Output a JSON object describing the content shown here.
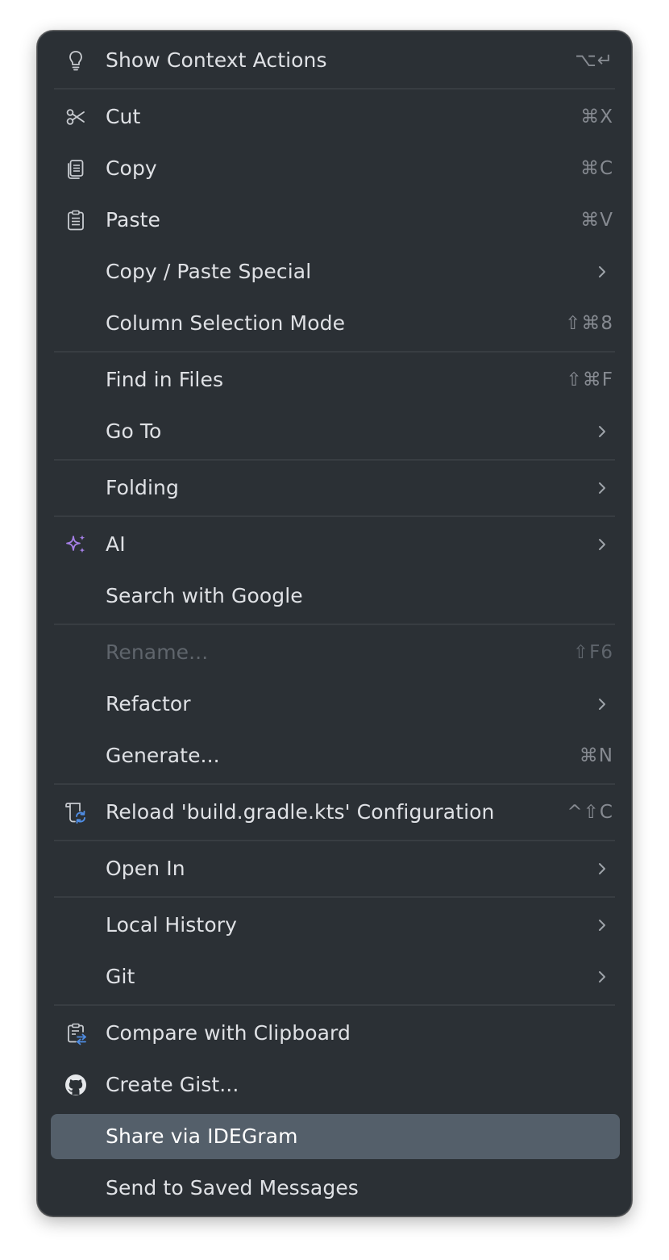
{
  "menu": {
    "show_context_actions": {
      "label": "Show Context Actions",
      "shortcut": "⌥↵",
      "icon": "lightbulb-icon"
    },
    "cut": {
      "label": "Cut",
      "shortcut": "⌘X",
      "icon": "scissors-icon"
    },
    "copy": {
      "label": "Copy",
      "shortcut": "⌘C",
      "icon": "copy-icon"
    },
    "paste": {
      "label": "Paste",
      "shortcut": "⌘V",
      "icon": "clipboard-icon"
    },
    "copy_paste_special": {
      "label": "Copy / Paste Special"
    },
    "column_selection_mode": {
      "label": "Column Selection Mode",
      "shortcut": "⇧⌘8"
    },
    "find_in_files": {
      "label": "Find in Files",
      "shortcut": "⇧⌘F"
    },
    "go_to": {
      "label": "Go To"
    },
    "folding": {
      "label": "Folding"
    },
    "ai": {
      "label": "AI",
      "icon": "ai-sparkle-icon",
      "icon_color": "#a57fe6"
    },
    "search_with_google": {
      "label": "Search with Google"
    },
    "rename": {
      "label": "Rename...",
      "shortcut": "⇧F6",
      "disabled": true
    },
    "refactor": {
      "label": "Refactor"
    },
    "generate": {
      "label": "Generate...",
      "shortcut": "⌘N"
    },
    "reload_gradle": {
      "label": "Reload 'build.gradle.kts' Configuration",
      "shortcut": "^⇧C",
      "icon": "gradle-reload-icon"
    },
    "open_in": {
      "label": "Open In"
    },
    "local_history": {
      "label": "Local History"
    },
    "git": {
      "label": "Git"
    },
    "compare_with_clipboard": {
      "label": "Compare with Clipboard",
      "icon": "compare-clipboard-icon"
    },
    "create_gist": {
      "label": "Create Gist...",
      "icon": "github-icon"
    },
    "share_via_idegram": {
      "label": "Share via IDEGram",
      "highlighted": true
    },
    "send_to_saved_messages": {
      "label": "Send to Saved Messages"
    }
  },
  "colors": {
    "menu_background": "#2b3035",
    "highlight_background": "#545f6a",
    "text": "#dfe1e5",
    "shortcut_text": "#868a91",
    "disabled_text": "#5f656c",
    "ai_accent": "#a57fe6",
    "reload_accent": "#4f8de4"
  }
}
